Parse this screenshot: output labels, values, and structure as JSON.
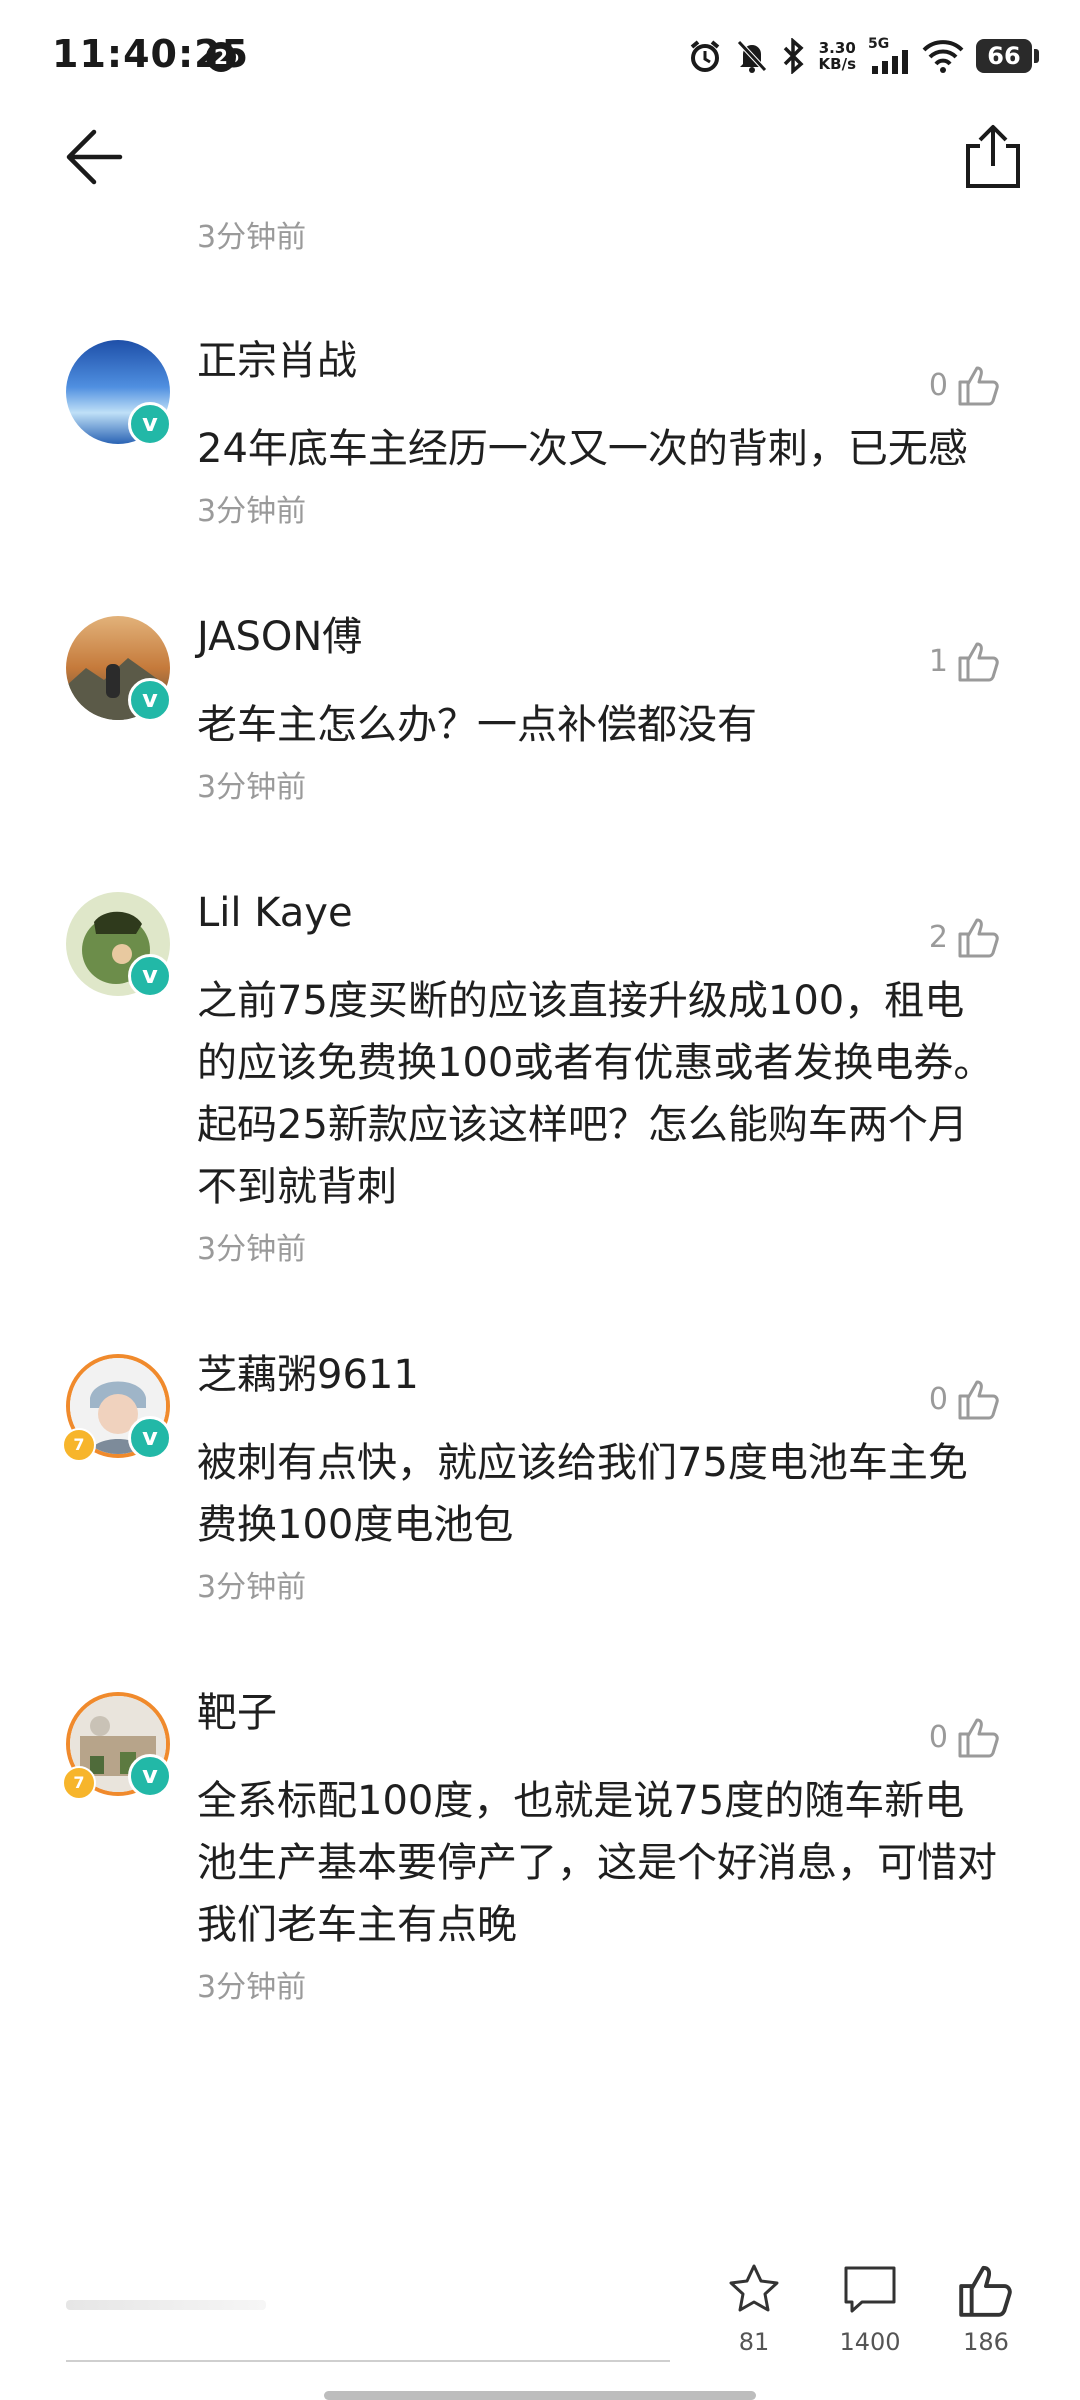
{
  "status_bar": {
    "time": "11:40:25",
    "notification_count": "2",
    "net_speed_value": "3.30",
    "net_speed_unit": "KB/s",
    "signal_label": "5G",
    "battery": "66"
  },
  "top_item": {
    "time": "3分钟前"
  },
  "comments": [
    {
      "user": "正宗肖战",
      "likes": "0",
      "text": "24年底车主经历一次又一次的背刺，已无感",
      "time": "3分钟前"
    },
    {
      "user": "JASON傅",
      "likes": "1",
      "text": "老车主怎么办？一点补偿都没有",
      "time": "3分钟前"
    },
    {
      "user": "Lil Kaye",
      "likes": "2",
      "text": "之前75度买断的应该直接升级成100，租电的应该免费换100或者有优惠或者发换电券。起码25新款应该这样吧？怎么能购车两个月不到就背刺",
      "time": "3分钟前"
    },
    {
      "user": "芝藕粥9611",
      "likes": "0",
      "text": "被刺有点快，就应该给我们75度电池车主免费换100度电池包",
      "time": "3分钟前"
    },
    {
      "user": "靶子",
      "likes": "0",
      "text": "全系标配100度，也就是说75度的随车新电池生产基本要停产了，这是个好消息，可惜对我们老车主有点晚",
      "time": "3分钟前"
    }
  ],
  "bottom_bar": {
    "favorite_count": "81",
    "comment_count": "1400",
    "like_count": "186"
  },
  "colors": {
    "accent_badge": "#22b8a7",
    "level_badge": "#f7b52b",
    "muted_text": "#9a9a9a"
  }
}
